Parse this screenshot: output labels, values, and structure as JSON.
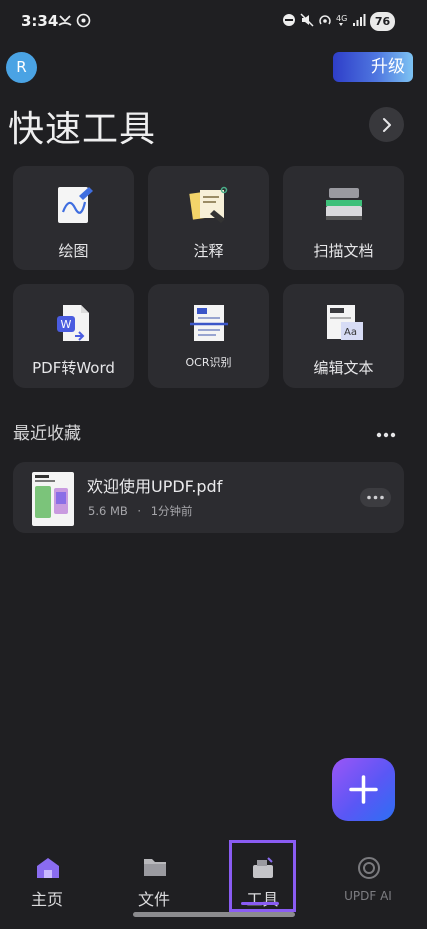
{
  "status": {
    "time": "3:34",
    "battery": "76"
  },
  "header": {
    "avatar_initial": "R",
    "upgrade_label": "升级"
  },
  "title": "快速工具",
  "tools": [
    {
      "label": "绘图",
      "icon": "drawing-icon"
    },
    {
      "label": "注释",
      "icon": "annotation-icon"
    },
    {
      "label": "扫描文档",
      "icon": "scanner-icon"
    },
    {
      "label": "PDF转Word",
      "icon": "pdf-to-word-icon"
    },
    {
      "label": "OCR识别",
      "icon": "ocr-icon"
    },
    {
      "label": "编辑文本",
      "icon": "edit-text-icon"
    }
  ],
  "favorites": {
    "title": "最近收藏",
    "files": [
      {
        "name": "欢迎使用UPDF.pdf",
        "size": "5.6 MB",
        "separator": "·",
        "time": "1分钟前"
      }
    ]
  },
  "nav": {
    "items": [
      {
        "label": "主页",
        "icon": "home-icon"
      },
      {
        "label": "文件",
        "icon": "folder-icon"
      },
      {
        "label": "工具",
        "icon": "toolbox-icon",
        "active": true
      },
      {
        "label": "UPDF AI",
        "icon": "ai-icon"
      }
    ]
  },
  "colors": {
    "background": "#1f1f22",
    "card": "#2c2c30",
    "accent": "#8a5cf3",
    "avatar": "#4aa3e4"
  }
}
